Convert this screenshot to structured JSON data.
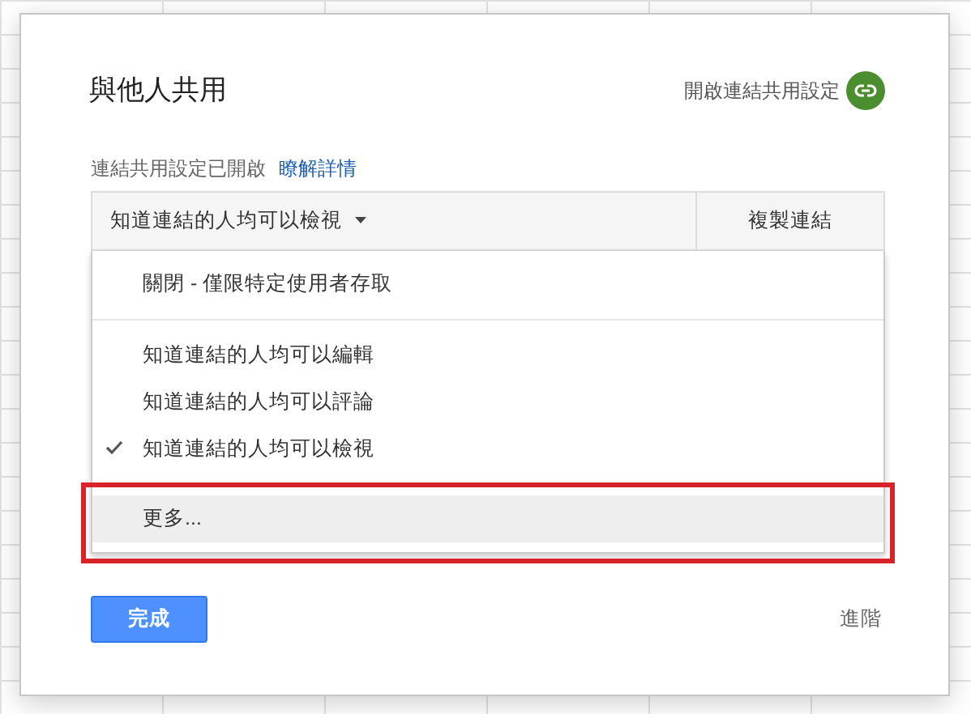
{
  "dialog": {
    "title": "與他人共用",
    "link_sharing_toggle": "開啟連結共用設定"
  },
  "status": {
    "text": "連結共用設定已開啟",
    "link": "瞭解詳情"
  },
  "access_select": {
    "value": "知道連結的人均可以檢視",
    "copy_button": "複製連結"
  },
  "menu": [
    {
      "label": "關閉 - 僅限特定使用者存取",
      "kind": "option",
      "selected": false,
      "highlighted": false
    },
    {
      "kind": "divider"
    },
    {
      "label": "知道連結的人均可以編輯",
      "kind": "option",
      "selected": false,
      "highlighted": false
    },
    {
      "label": "知道連結的人均可以評論",
      "kind": "option",
      "selected": false,
      "highlighted": false
    },
    {
      "label": "知道連結的人均可以檢視",
      "kind": "option",
      "selected": true,
      "highlighted": false
    },
    {
      "label": "更多...",
      "kind": "option",
      "selected": false,
      "highlighted": true,
      "annotated": true
    }
  ],
  "buttons": {
    "done": "完成",
    "advanced": "進階"
  }
}
